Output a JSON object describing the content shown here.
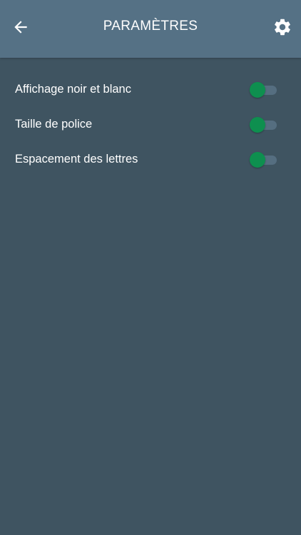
{
  "app_bar": {
    "title": "PARAMÈTRES",
    "back_icon": "arrow-left-icon",
    "settings_icon": "gear-icon"
  },
  "settings": [
    {
      "label": "Affichage noir et blanc",
      "enabled": false
    },
    {
      "label": "Taille de police",
      "enabled": false
    },
    {
      "label": "Espacement des lettres",
      "enabled": false
    }
  ],
  "colors": {
    "background": "#3f5461",
    "app_bar": "#557185",
    "toggle_thumb": "#0e8f4f",
    "toggle_track": "#556e80",
    "text": "#ffffff"
  }
}
